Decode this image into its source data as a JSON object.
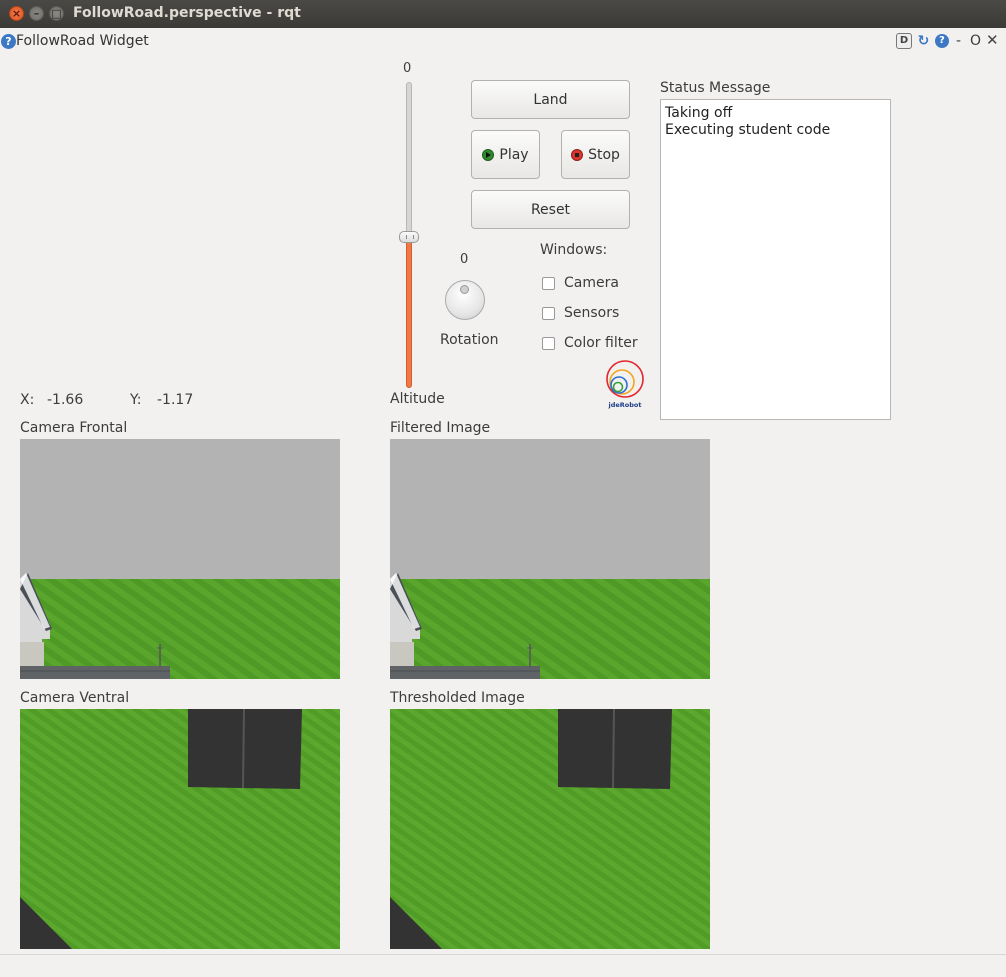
{
  "window": {
    "title": "FollowRoad.perspective - rqt",
    "close_glyph": "×",
    "min_glyph": "–",
    "max_glyph": "□"
  },
  "widget": {
    "title": "FollowRoad Widget",
    "help_glyph": "?",
    "d_glyph": "D",
    "reload_glyph": "↻",
    "help2_glyph": "?",
    "dash_glyph": "-",
    "float_glyph": "O",
    "close_glyph": "✕"
  },
  "altitude": {
    "value": "0",
    "label": "Altitude",
    "level_fraction": 0.5
  },
  "buttons": {
    "land": "Land",
    "play": "Play",
    "stop": "Stop",
    "reset": "Reset"
  },
  "rotation": {
    "value": "0",
    "label": "Rotation"
  },
  "windows": {
    "label": "Windows:",
    "options": [
      {
        "label": "Camera",
        "checked": false
      },
      {
        "label": "Sensors",
        "checked": false
      },
      {
        "label": "Color filter",
        "checked": false
      }
    ]
  },
  "logo": {
    "text": "jdeRobot"
  },
  "status": {
    "label": "Status Message",
    "lines": [
      "Taking off",
      "Executing student code"
    ]
  },
  "position": {
    "x_label": "X:",
    "x_value": "-1.66",
    "y_label": "Y:",
    "y_value": "-1.17"
  },
  "images": {
    "camera_frontal": "Camera Frontal",
    "filtered_image": "Filtered Image",
    "camera_ventral": "Camera Ventral",
    "thresholded_image": "Thresholded Image"
  },
  "colors": {
    "slider_fill": "#f07746",
    "sky": "#b3b3b3",
    "grass": "#56a12a",
    "road": "#333333"
  }
}
